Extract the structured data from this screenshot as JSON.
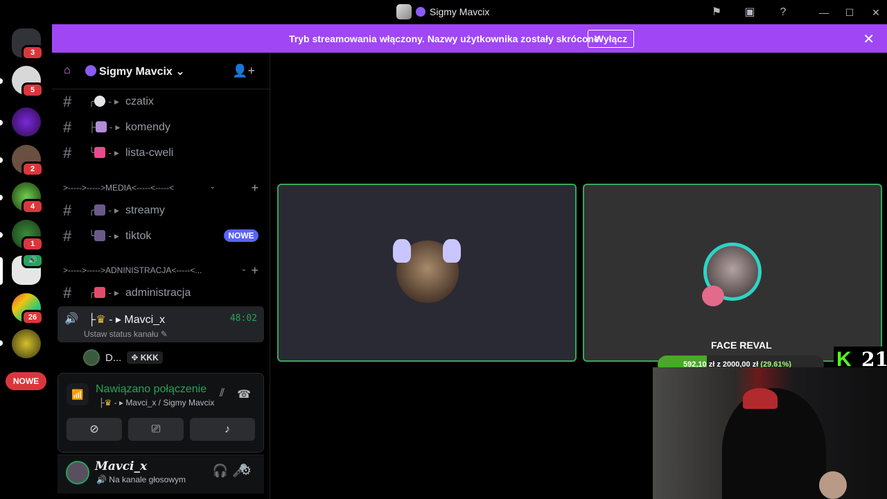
{
  "titlebar": {
    "title": "Sigmy Mavcix"
  },
  "rail": {
    "badges": [
      "3",
      "5",
      "2",
      "4",
      "1",
      "26"
    ],
    "new_label": "NOWE"
  },
  "banner": {
    "message": "Tryb streamowania włączony. Nazwy użytkownika zostały skrócone.",
    "button": "Wyłącz"
  },
  "server": {
    "name": "Sigmy Mavcix"
  },
  "channels": {
    "c1": "czatix",
    "c2": "komendy",
    "c3": "lista-cweli",
    "cat_media": ">----->----->MEDIA<-----<-----<",
    "c4": "streamy",
    "c5": "tiktok",
    "c5_badge": "NOWE",
    "cat_admin": ">----->----->ADNINISTRACJA<-----<...",
    "c6": "administracja"
  },
  "voice_channel": {
    "name": "Mavci_x",
    "timer": "48:02",
    "status": "Ustaw status kanału"
  },
  "voice_member": {
    "name": "D...",
    "tag": "KKK"
  },
  "voice_panel": {
    "title": "Nawiązano połączenie",
    "subtitle": "Mavci_x / Sigmy Mavcix"
  },
  "user": {
    "name": "Mavci_x",
    "status": "Na kanale głosowym"
  },
  "stream": {
    "goal_title": "FACE REVAL",
    "goal_progress": 0.2961,
    "goal_current": "592,10 zł",
    "goal_sep": "z",
    "goal_target": "2000,00 zł",
    "goal_pct": "(29.61%)",
    "kick_count": "21"
  },
  "colors": {
    "banner": "#a046f5",
    "speaking_border": "#3ba55d",
    "badge_red": "#da373c",
    "kick_green": "#53fc18"
  }
}
